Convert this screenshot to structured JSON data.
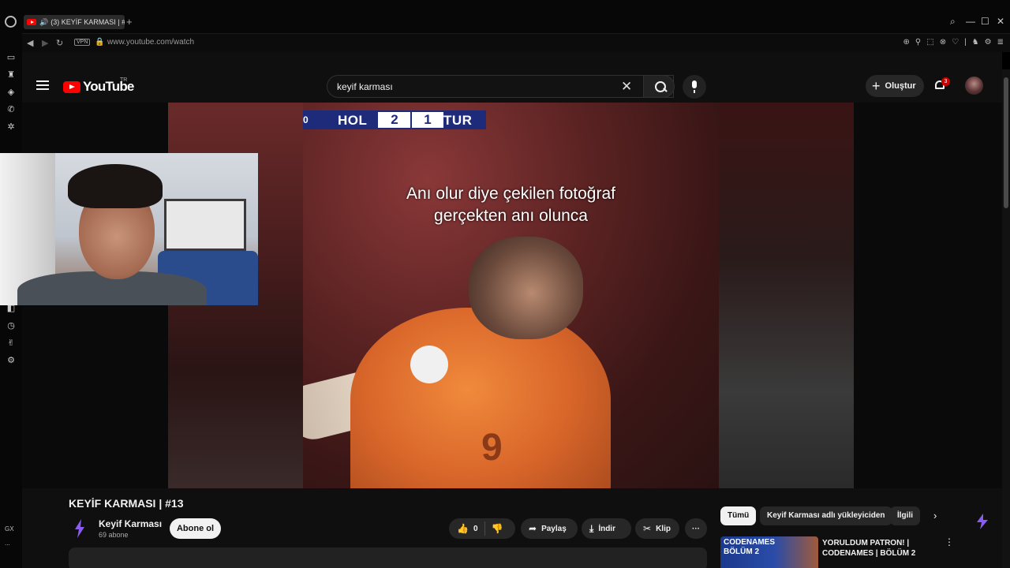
{
  "browser": {
    "tab_title": "(3) KEYİF KARMASI | #",
    "url": "www.youtube.com/watch",
    "vpn_label": "VPN",
    "sidebar_label": "GX",
    "sidebar_more": "..."
  },
  "header": {
    "logo_text": "YouTube",
    "country": "TR",
    "search_value": "keyif karması",
    "create_label": "Oluştur",
    "notification_count": "3"
  },
  "video_overlay": {
    "team_left": "HOL",
    "score_left": "2",
    "score_right": "1",
    "team_right": "TUR",
    "edge_marker": "0",
    "caption_line1": "Anı olur diye çekilen fotoğraf",
    "caption_line2": "gerçekten anı olunca",
    "jersey_number": "9"
  },
  "video": {
    "title": "KEYİF KARMASI | #13",
    "channel_name": "Keyif Karması",
    "channel_avatar_text": "KEYİF KARMASI",
    "subscribers": "69 abone",
    "subscribe_label": "Abone ol",
    "like_count": "0",
    "share_label": "Paylaş",
    "download_label": "İndir",
    "clip_label": "Klip",
    "more_label": "···"
  },
  "recommendations": {
    "chips": [
      "Tümü",
      "Keyif Karması adlı yükleyiciden",
      "İlgili"
    ],
    "item": {
      "thumb_line1": "CODENAMES",
      "thumb_line2": "BÖLÜM 2",
      "title_line1": "YORULDUM PATRON! |",
      "title_line2": "CODENAMES | BÖLÜM 2"
    }
  },
  "colors": {
    "brand_red": "#ff0000",
    "page_bg": "#0f0f0f",
    "jersey_orange": "#e0702e",
    "scoreboard_blue": "#1e2a7a"
  }
}
